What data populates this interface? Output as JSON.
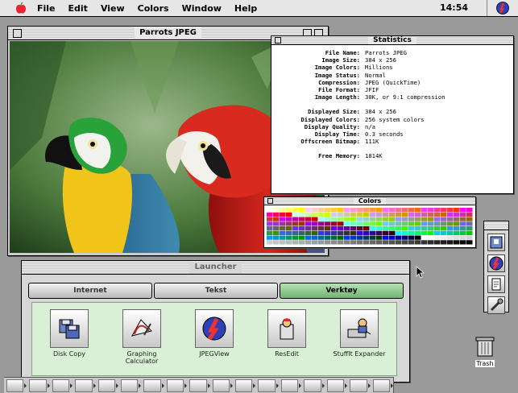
{
  "menubar": {
    "items": [
      "File",
      "Edit",
      "View",
      "Colors",
      "Window",
      "Help"
    ],
    "clock": "14:54",
    "apple_icon": "apple-icon",
    "app_icon": "jpegview-app-icon"
  },
  "image_window": {
    "title": "Parrots JPEG"
  },
  "stats_window": {
    "title": "Statistics",
    "rows": [
      {
        "label": "File Name:",
        "value": "Parrots JPEG"
      },
      {
        "label": "Image Size:",
        "value": "384 x 256"
      },
      {
        "label": "Image Colors:",
        "value": "Millions"
      },
      {
        "label": "Image Status:",
        "value": "Normal"
      },
      {
        "label": "Compression:",
        "value": "JPEG (QuickTime)"
      },
      {
        "label": "File Format:",
        "value": "JFIF"
      },
      {
        "label": "Image Length:",
        "value": "30K, or 9:1 compression"
      }
    ],
    "rows2": [
      {
        "label": "Displayed Size:",
        "value": "384 x 256"
      },
      {
        "label": "Displayed Colors:",
        "value": "256 system colors"
      },
      {
        "label": "Display Quality:",
        "value": "n/a"
      },
      {
        "label": "Display Time:",
        "value": "0.3 seconds"
      },
      {
        "label": "Offscreen Bitmap:",
        "value": "111K"
      }
    ],
    "rows3": [
      {
        "label": "Free Memory:",
        "value": "1814K"
      }
    ]
  },
  "colors_window": {
    "title": "Colors"
  },
  "launcher": {
    "title": "Launcher",
    "tabs": [
      {
        "label": "Internet",
        "active": false
      },
      {
        "label": "Tekst",
        "active": false
      },
      {
        "label": "Verktøy",
        "active": true
      }
    ],
    "items": [
      {
        "label": "Disk Copy",
        "icon": "disk-copy-icon"
      },
      {
        "label": "Graphing Calculator",
        "icon": "graphing-calculator-icon"
      },
      {
        "label": "JPEGView",
        "icon": "jpegview-icon"
      },
      {
        "label": "ResEdit",
        "icon": "resedit-icon"
      },
      {
        "label": "StuffIt Expander",
        "icon": "stuffit-expander-icon"
      }
    ]
  },
  "trash": {
    "label": "Trash"
  },
  "colors": {
    "accent_green": "#6fb56f",
    "panel_green": "#d9f0d6",
    "desktop": "#9a9a9a"
  }
}
